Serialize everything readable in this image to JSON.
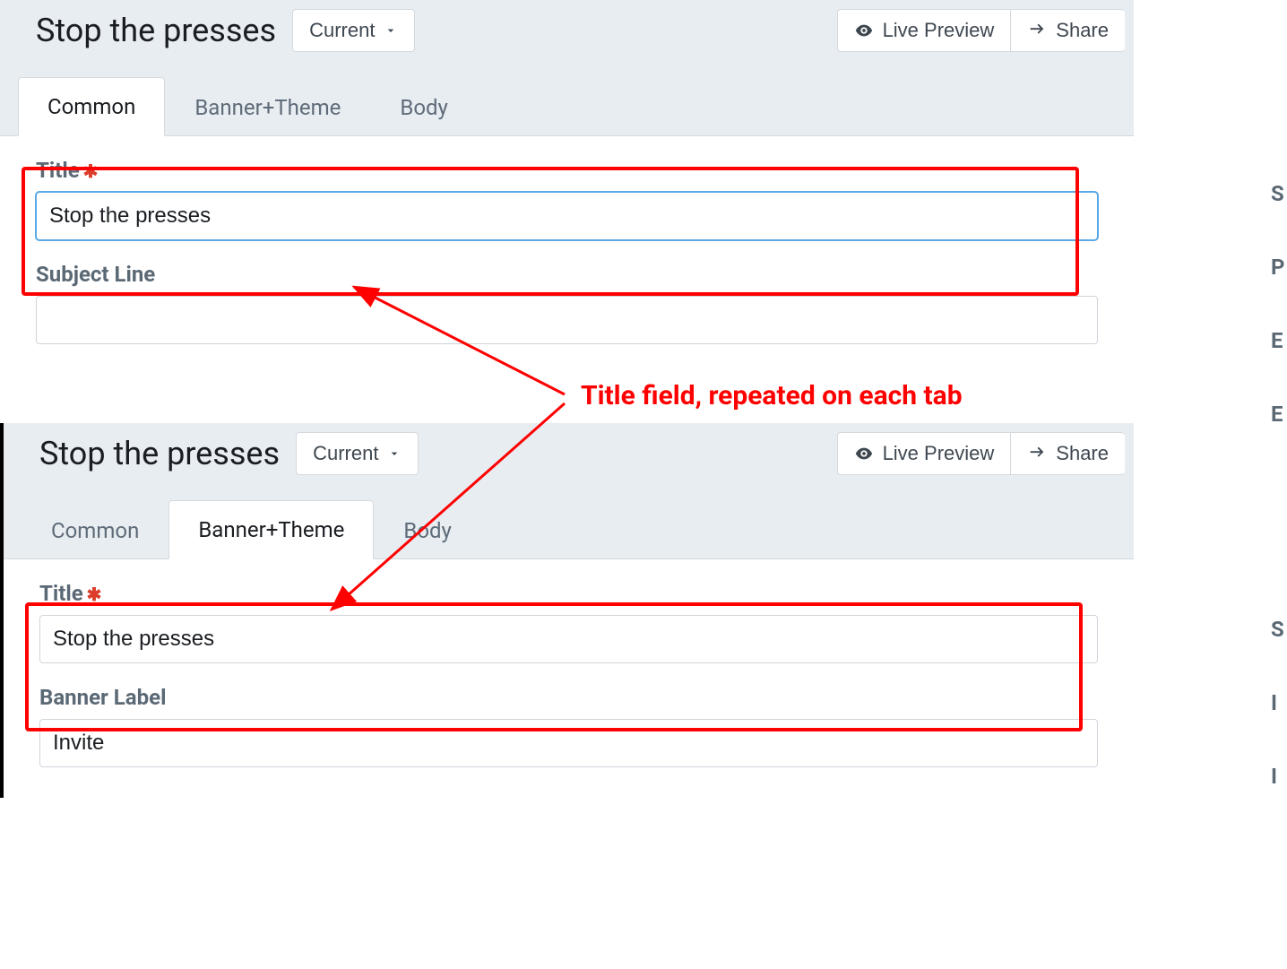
{
  "top": {
    "heading": "Stop the presses",
    "current_btn": "Current",
    "live_preview": "Live Preview",
    "share": "Share",
    "tabs": {
      "common": "Common",
      "banner": "Banner+Theme",
      "body": "Body"
    },
    "title_label": "Title",
    "title_value": "Stop the presses",
    "subject_label": "Subject Line",
    "subject_value": ""
  },
  "bottom": {
    "heading": "Stop the presses",
    "current_btn": "Current",
    "live_preview": "Live Preview",
    "share": "Share",
    "tabs": {
      "common": "Common",
      "banner": "Banner+Theme",
      "body": "Body"
    },
    "title_label": "Title",
    "title_value": "Stop the presses",
    "banner_label": "Banner Label",
    "banner_value": "Invite"
  },
  "annotation": {
    "callout": "Title field, repeated on each tab"
  },
  "sidebar": {
    "top": [
      "S",
      "P",
      "E",
      "E"
    ],
    "bottom": [
      "S",
      "I",
      "I"
    ]
  }
}
